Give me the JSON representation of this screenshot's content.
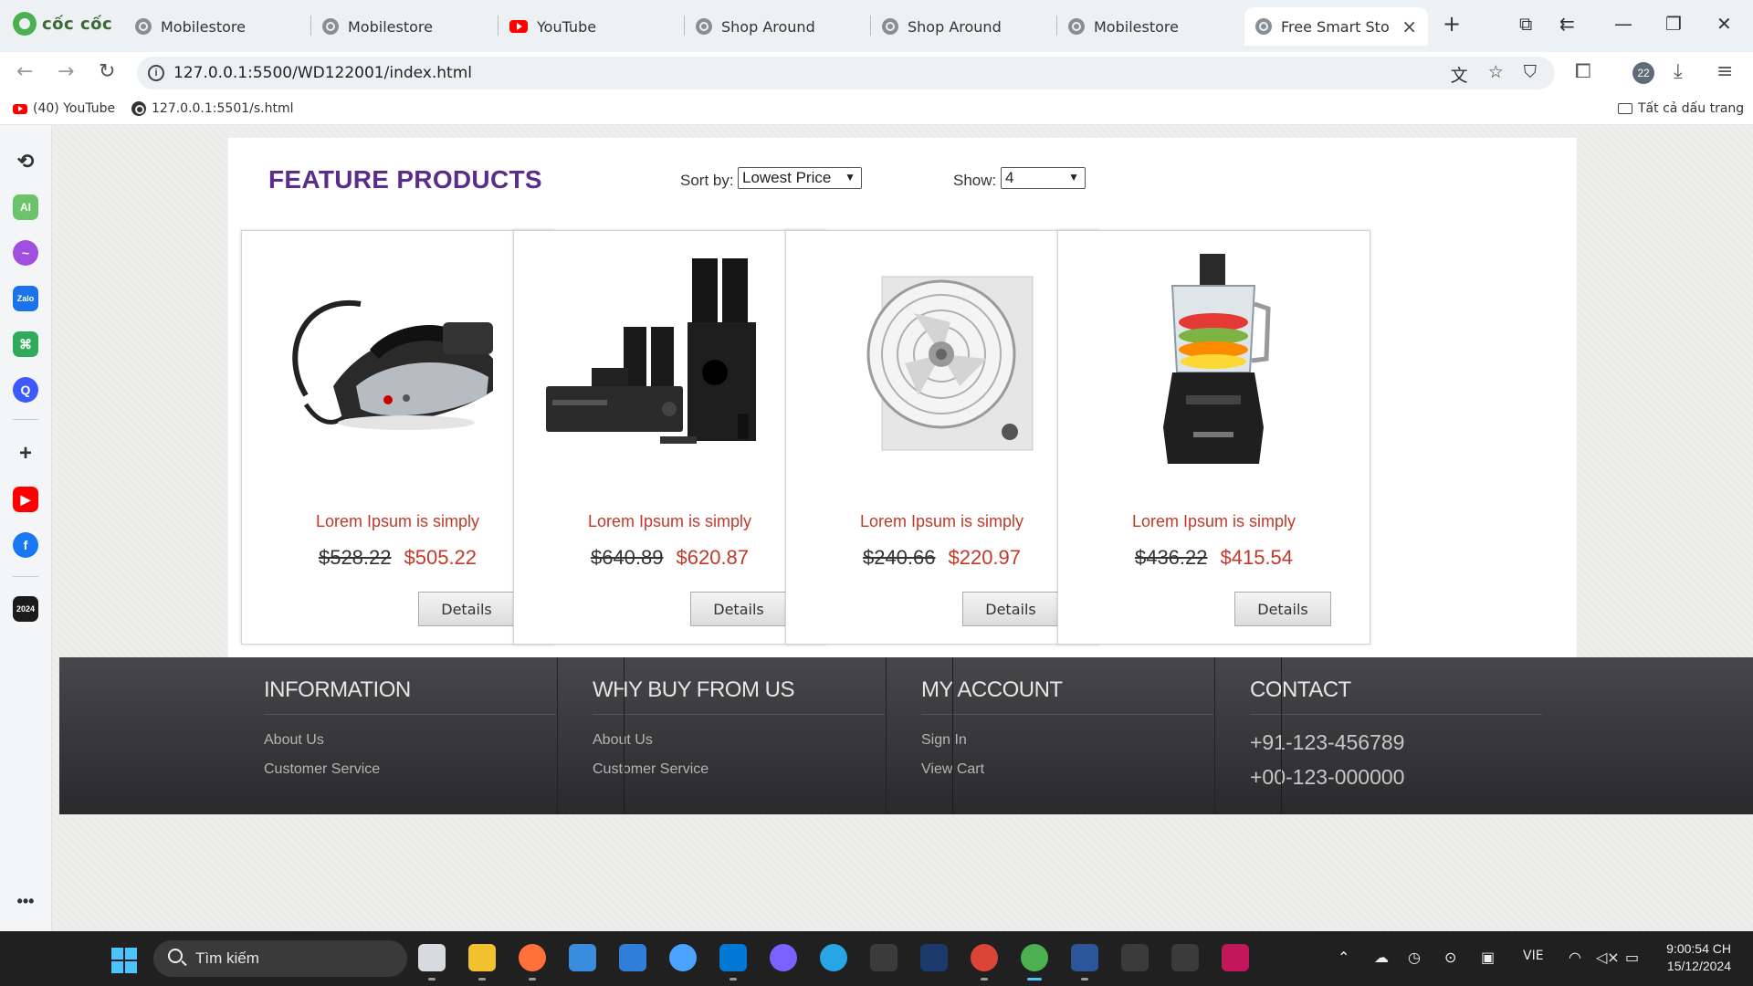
{
  "browser": {
    "logo_text": "cốc cốc",
    "tabs": [
      {
        "title": "Mobilestore",
        "icon": "globe-icon"
      },
      {
        "title": "Mobilestore",
        "icon": "globe-icon"
      },
      {
        "title": "YouTube",
        "icon": "youtube-icon"
      },
      {
        "title": "Shop Around",
        "icon": "globe-icon"
      },
      {
        "title": "Shop Around",
        "icon": "globe-icon"
      },
      {
        "title": "Mobilestore",
        "icon": "globe-icon"
      },
      {
        "title": "Free Smart Store",
        "icon": "globe-icon",
        "active": true
      }
    ],
    "url": "127.0.0.1:5500/WD122001/index.html",
    "profile_badge": "22",
    "bookmarks": [
      {
        "label": "(40) YouTube",
        "icon": "youtube-icon"
      },
      {
        "label": "127.0.0.1:5501/s.html",
        "icon": "globe-icon"
      }
    ],
    "all_bookmarks": "Tất cả dấu trang"
  },
  "page": {
    "heading": "FEATURE PRODUCTS",
    "sort_label": "Sort by:",
    "sort_value": "Lowest Price",
    "show_label": "Show:",
    "show_value": "4",
    "products": [
      {
        "title": "Lorem Ipsum is simply",
        "old_price": "$528.22",
        "new_price": "$505.22",
        "button": "Details",
        "image": "steam-iron"
      },
      {
        "title": "Lorem Ipsum is simply",
        "old_price": "$640.89",
        "new_price": "$620.87",
        "button": "Details",
        "image": "home-theater-speakers"
      },
      {
        "title": "Lorem Ipsum is simply",
        "old_price": "$240.66",
        "new_price": "$220.97",
        "button": "Details",
        "image": "box-fan"
      },
      {
        "title": "Lorem Ipsum is simply",
        "old_price": "$436.22",
        "new_price": "$415.54",
        "button": "Details",
        "image": "food-processor"
      }
    ]
  },
  "footer": {
    "columns": [
      {
        "title": "INFORMATION",
        "links": [
          "About Us",
          "Customer Service"
        ]
      },
      {
        "title": "WHY BUY FROM US",
        "links": [
          "About Us",
          "Customer Service"
        ]
      },
      {
        "title": "MY ACCOUNT",
        "links": [
          "Sign In",
          "View Cart"
        ]
      },
      {
        "title": "CONTACT",
        "phones": [
          "+91-123-456789",
          "+00-123-000000"
        ]
      }
    ]
  },
  "taskbar": {
    "search_placeholder": "Tìm kiếm",
    "language": "VIE",
    "time": "9:00:54 CH",
    "date": "15/12/2024",
    "chrome_badge": "22"
  },
  "colors": {
    "heading": "#5b2d8a",
    "price_accent": "#c0392b",
    "footer_bg": "#3a3a3c"
  }
}
